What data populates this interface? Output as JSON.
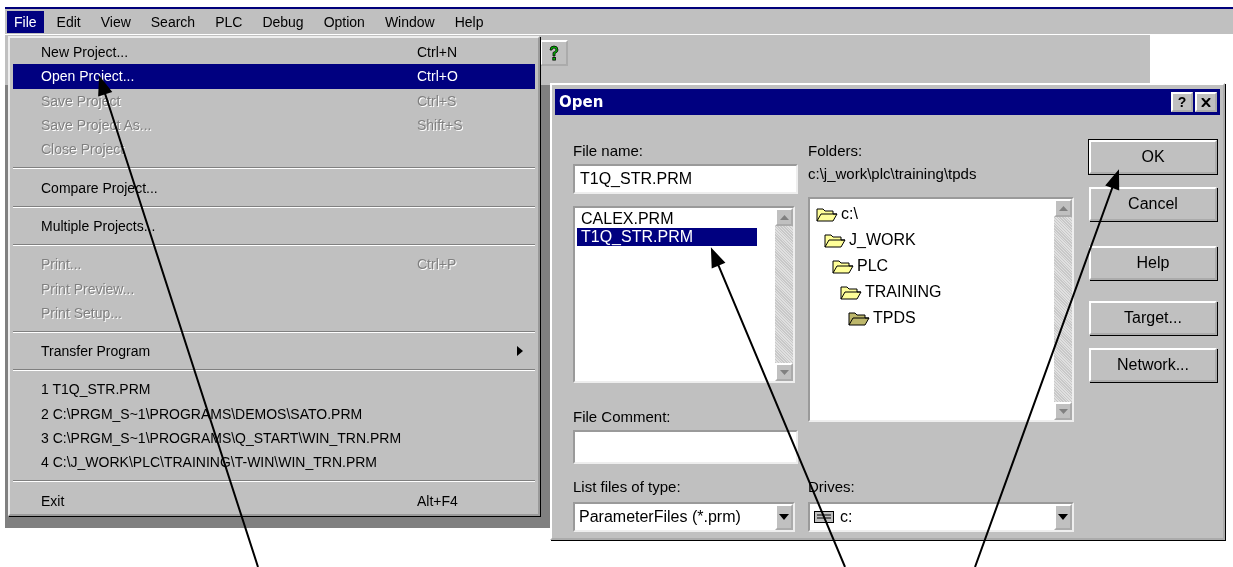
{
  "menubar": [
    {
      "label": "File",
      "selected": true
    },
    {
      "label": "Edit",
      "selected": false
    },
    {
      "label": "View",
      "selected": false
    },
    {
      "label": "Search",
      "selected": false
    },
    {
      "label": "PLC",
      "selected": false
    },
    {
      "label": "Debug",
      "selected": false
    },
    {
      "label": "Option",
      "selected": false
    },
    {
      "label": "Window",
      "selected": false
    },
    {
      "label": "Help",
      "selected": false
    }
  ],
  "file_menu": [
    {
      "kind": "item",
      "label": "New Project...",
      "shortcut": "Ctrl+N",
      "disabled": false,
      "selected": false
    },
    {
      "kind": "item",
      "label": "Open Project...",
      "shortcut": "Ctrl+O",
      "disabled": false,
      "selected": true
    },
    {
      "kind": "item",
      "label": "Save Project",
      "shortcut": "Ctrl+S",
      "disabled": true,
      "selected": false
    },
    {
      "kind": "item",
      "label": "Save Project As...",
      "shortcut": "Shift+S",
      "disabled": true,
      "selected": false
    },
    {
      "kind": "item",
      "label": "Close Project",
      "disabled": true,
      "selected": false
    },
    {
      "kind": "separator"
    },
    {
      "kind": "item",
      "label": "Compare Project...",
      "disabled": false,
      "selected": false
    },
    {
      "kind": "separator"
    },
    {
      "kind": "item",
      "label": "Multiple Projects...",
      "disabled": false,
      "selected": false
    },
    {
      "kind": "separator"
    },
    {
      "kind": "item",
      "label": "Print...",
      "shortcut": "Ctrl+P",
      "disabled": true,
      "selected": false
    },
    {
      "kind": "item",
      "label": "Print Preview...",
      "disabled": true,
      "selected": false
    },
    {
      "kind": "item",
      "label": "Print Setup...",
      "disabled": true,
      "selected": false
    },
    {
      "kind": "separator"
    },
    {
      "kind": "submenu",
      "label": "Transfer Program",
      "disabled": false,
      "selected": false
    },
    {
      "kind": "separator"
    },
    {
      "kind": "item",
      "label": "1 T1Q_STR.PRM",
      "disabled": false,
      "selected": false
    },
    {
      "kind": "item",
      "label": "2 C:\\PRGM_S~1\\PROGRAMS\\DEMOS\\SATO.PRM",
      "disabled": false,
      "selected": false
    },
    {
      "kind": "item",
      "label": "3 C:\\PRGM_S~1\\PROGRAMS\\Q_START\\WIN_TRN.PRM",
      "disabled": false,
      "selected": false
    },
    {
      "kind": "item",
      "label": "4 C:\\J_WORK\\PLC\\TRAINING\\T-WIN\\WIN_TRN.PRM",
      "disabled": false,
      "selected": false
    },
    {
      "kind": "separator"
    },
    {
      "kind": "item",
      "label": "Exit",
      "shortcut": "Alt+F4",
      "disabled": false,
      "selected": false
    }
  ],
  "dialog": {
    "title": "Open",
    "help_button": "?",
    "file_name": {
      "label": "File name:",
      "value": "T1Q_STR.PRM"
    },
    "files": [
      {
        "name": "CALEX.PRM",
        "selected": false
      },
      {
        "name": "T1Q_STR.PRM",
        "selected": true
      }
    ],
    "file_comment": {
      "label": "File Comment:"
    },
    "file_type": {
      "label": "List files of type:",
      "value": "ParameterFiles (*.prm)"
    },
    "folders": {
      "label": "Folders:",
      "path": "c:\\j_work\\plc\\training\\tpds",
      "tree": [
        {
          "name": "c:\\",
          "selected": false,
          "children": [
            {
              "name": "J_WORK",
              "selected": false,
              "children": [
                {
                  "name": "PLC",
                  "selected": false,
                  "children": [
                    {
                      "name": "TRAINING",
                      "selected": false,
                      "children": [
                        {
                          "name": "TPDS",
                          "selected": true
                        }
                      ]
                    }
                  ]
                }
              ]
            }
          ]
        }
      ]
    },
    "drives": {
      "label": "Drives:",
      "value": "c:"
    },
    "buttons": [
      {
        "label": "OK",
        "default": true
      },
      {
        "label": "Cancel",
        "default": false
      },
      {
        "label": "Help",
        "default": false
      },
      {
        "label": "Target...",
        "default": false
      },
      {
        "label": "Network...",
        "default": false
      }
    ]
  }
}
